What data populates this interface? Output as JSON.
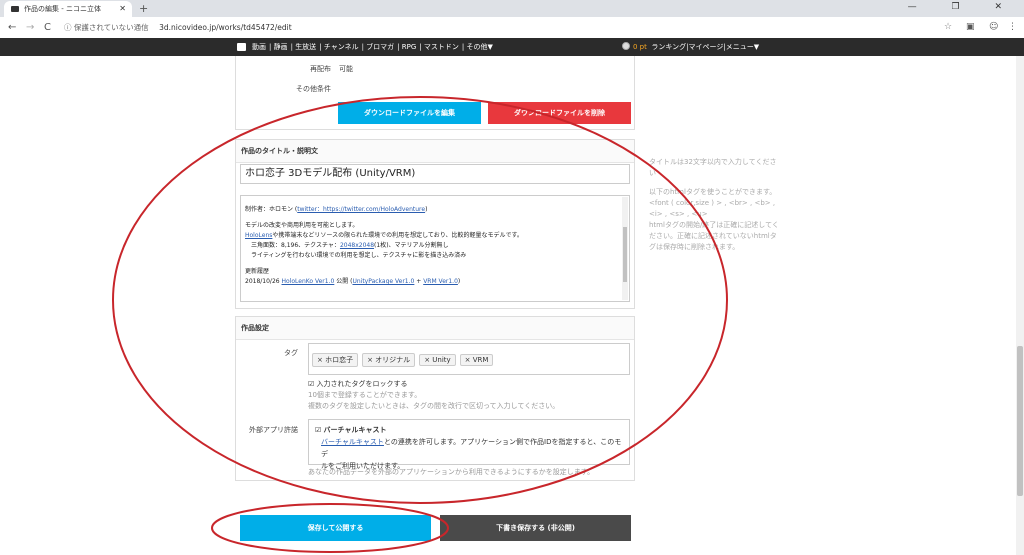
{
  "browser": {
    "tab_title": "作品の編集 - ニコニ立体",
    "tab_close": "✕",
    "new_tab": "+",
    "window_controls": "— ❐ ✕",
    "back": "←",
    "forward": "→",
    "reload": "C",
    "security_label": "ⓘ 保護されていない通信",
    "url": "3d.nicovideo.jp/works/td45472/edit",
    "star": "☆",
    "ext_icons": [
      "▣",
      "☺",
      "⋮"
    ]
  },
  "site_header": {
    "links": [
      "動画",
      "静画",
      "生放送",
      "チャンネル",
      "ブロマガ",
      "RPG",
      "マストドン",
      "その他▼"
    ],
    "points": "0 pt",
    "right_links": [
      "ランキング",
      "マイページ",
      "メニュー▼"
    ]
  },
  "top_section": {
    "redistribution_label": "再配布",
    "redistribution_value": "可能",
    "other_conditions_label": "その他条件",
    "edit_download_button": "ダウンロードファイルを編集",
    "delete_download_button": "ダウンロードファイルを削除"
  },
  "title_section": {
    "heading": "作品のタイトル・説明文",
    "title_value": "ホロ恋子 3Dモデル配布 (Unity/VRM)",
    "description": {
      "line1_prefix": "制作者：ホロモン (",
      "line1_link": "twitter：https://twitter.com/HoloAdventure",
      "line1_suffix": ")",
      "line2": "モデルの改変や商用利用を可能とします。",
      "line3_link": "HoloLens",
      "line3_text": "や携帯端末などリソースの限られた環境での利用を想定しており、比較的軽量なモデルです。",
      "line4_prefix": "　三角面数：8,196、テクスチャ：",
      "line4_link": "2048x2048",
      "line4_suffix": "(1枚)、マテリアル分割無し",
      "line5": "　ライティングを行わない環境での利用を想定し、テクスチャに影を描き込み済み",
      "line6": "更新履歴",
      "line7_prefix": "2018/10/26 ",
      "line7_link": "HoloLenKo Ver1.0",
      "line7_mid": " 公開 (",
      "line7_link2": "UnityPackage Ver1.0",
      "line7_mid2": " + ",
      "line7_link3": "VRM Ver1.0",
      "line7_suffix": ")"
    }
  },
  "side_help": {
    "line1": "タイトルは32文字以内で入力してください",
    "line2": "以下のhtmlタグを使うことができます。",
    "line3": "<font ( color,size ) > , <br> , <b> , <i> , <s> , <u>",
    "line4": "htmlタグの開始/終了は正確に記述してください。正確に記述されていないhtmlタグは保存時に削除されます。"
  },
  "settings_section": {
    "heading": "作品設定",
    "tag_label": "タグ",
    "tags": [
      "× ホロ恋子",
      "× オリジナル",
      "× Unity",
      "× VRM"
    ],
    "lock_checkbox": "☑",
    "lock_label": "入力されたタグをロックする",
    "tag_hint1": "10個まで登録することができます。",
    "tag_hint2": "複数のタグを設定したいときは、タグの間を改行で区切って入力してください。",
    "external_label": "外部アプリ許諾",
    "vcast_checkbox": "☑",
    "vcast_label": "バーチャルキャスト",
    "vcast_desc_link": "バーチャルキャスト",
    "vcast_desc1": "との連携を許可します。アプリケーション側で作品IDを指定すると、このモデ",
    "vcast_desc2": "ルをご利用いただけます。",
    "external_hint": "あなたの作品データを外部のアプリケーションから利用できるようにするかを設定します。"
  },
  "actions": {
    "save_publish": "保存して公開する",
    "save_draft": "下書き保存する (非公開)"
  },
  "colors": {
    "primary_button": "#00aee8",
    "danger_button": "#e8383d",
    "draft_button": "#4a4a4a",
    "annotation_ellipse": "#c8262b"
  }
}
